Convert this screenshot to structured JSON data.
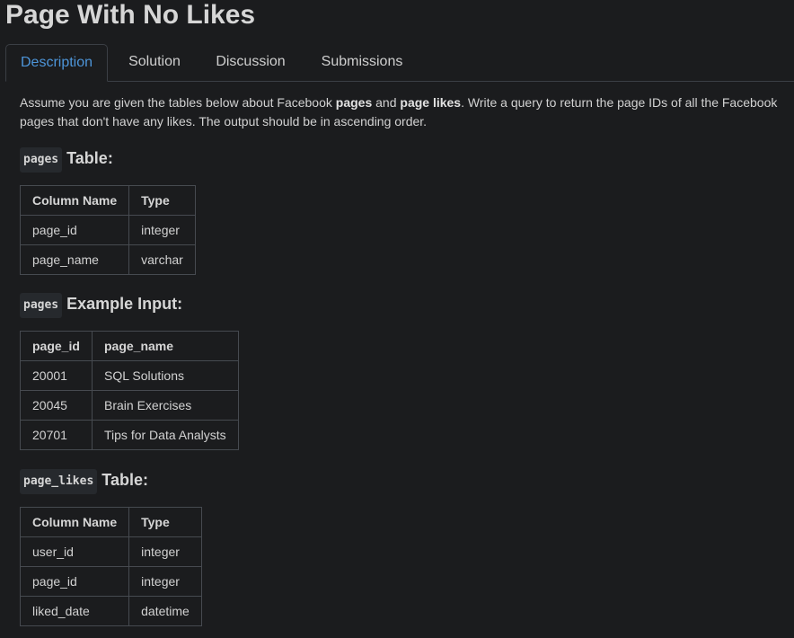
{
  "title": "Page With No Likes",
  "tabs": [
    {
      "label": "Description",
      "active": true
    },
    {
      "label": "Solution",
      "active": false
    },
    {
      "label": "Discussion",
      "active": false
    },
    {
      "label": "Submissions",
      "active": false
    }
  ],
  "description": {
    "part1": "Assume you are given the tables below about Facebook ",
    "bold1": "pages",
    "part2": " and ",
    "bold2": "page likes",
    "part3": ". Write a query to return the page IDs of all the Facebook pages that don't have any likes. The output should be in ascending order."
  },
  "sections": {
    "pages_table": {
      "code": "pages",
      "title": "Table:",
      "headers": [
        "Column Name",
        "Type"
      ],
      "rows": [
        [
          "page_id",
          "integer"
        ],
        [
          "page_name",
          "varchar"
        ]
      ]
    },
    "pages_example": {
      "code": "pages",
      "title": "Example Input:",
      "headers": [
        "page_id",
        "page_name"
      ],
      "rows": [
        [
          "20001",
          "SQL Solutions"
        ],
        [
          "20045",
          "Brain Exercises"
        ],
        [
          "20701",
          "Tips for Data Analysts"
        ]
      ]
    },
    "page_likes_table": {
      "code": "page_likes",
      "title": "Table:",
      "headers": [
        "Column Name",
        "Type"
      ],
      "rows": [
        [
          "user_id",
          "integer"
        ],
        [
          "page_id",
          "integer"
        ],
        [
          "liked_date",
          "datetime"
        ]
      ]
    }
  },
  "colors": {
    "background": "#1b1c1e",
    "active_tab": "#4d95d9",
    "border": "#464a50"
  }
}
